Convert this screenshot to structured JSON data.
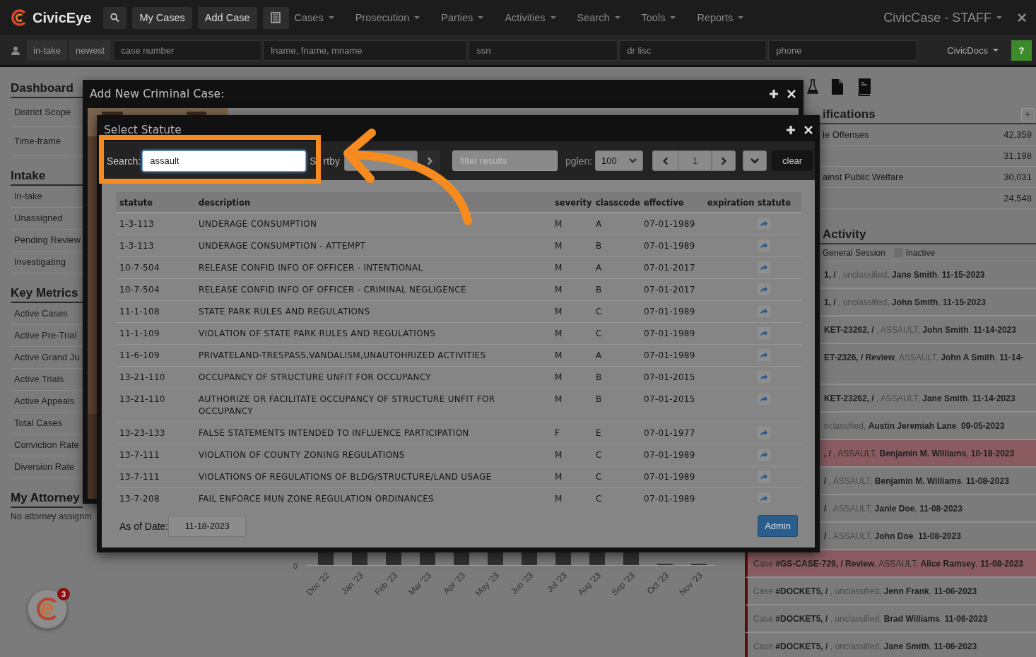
{
  "topbar": {
    "app_name": "CivicEye",
    "buttons": [
      "My Cases",
      "Add Case"
    ],
    "menus": [
      "Cases",
      "Prosecution",
      "Parties",
      "Activities",
      "Search",
      "Tools",
      "Reports"
    ],
    "account": "CivicCase - STAFF"
  },
  "quickbar": {
    "buttons": [
      "in-take",
      "newest"
    ],
    "fields": [
      {
        "placeholder": "case number"
      },
      {
        "placeholder": "lname, fname, mname"
      },
      {
        "placeholder": "ssn"
      },
      {
        "placeholder": "dr lisc"
      },
      {
        "placeholder": "phone"
      }
    ],
    "docs_menu": "CivicDocs",
    "help_button": "?"
  },
  "sidebar": {
    "sections": [
      {
        "heading": "Dashboard",
        "items": [
          "District Scope",
          "Time-frame"
        ]
      },
      {
        "heading": "Intake",
        "items": [
          "In-take",
          "Unassigned",
          "Pending Review",
          "Investigating"
        ]
      },
      {
        "heading": "Key Metrics",
        "items": [
          "Active Cases",
          "Active Pre-Trial",
          "Active Grand Ju",
          "Active Trials",
          "Active Appeals",
          "Total Cases",
          "Conviction Rate",
          "Diversion Rate"
        ]
      },
      {
        "heading": "My Attorney",
        "note": "No attorney assignm"
      }
    ]
  },
  "chart": {
    "y_tick": "0",
    "months": [
      "Dec '22",
      "Jan '23",
      "Feb '23",
      "Mar '23",
      "Apr '23",
      "May '23",
      "Jun '23",
      "Jul '23",
      "Aug '23",
      "Sep '23",
      "Oct '23",
      "Nov '23"
    ]
  },
  "right_panel": {
    "classifications": {
      "heading": "ifications",
      "add_button": "+",
      "rows": [
        {
          "label": "le Offenses",
          "count": "42,359"
        },
        {
          "count": "31,198"
        },
        {
          "label": "ainst Public Welfare",
          "count": "30,031"
        },
        {
          "count": "24,548"
        }
      ]
    },
    "activity": {
      "heading": "Activity",
      "legend": [
        {
          "label": "General Session"
        },
        {
          "label": "Inactive",
          "color": "#6e6e6e"
        }
      ],
      "items": [
        {
          "text": "**1, /** , unclassified, **Jane Smith**, **11-15-2023**",
          "highlighted": false,
          "wrapped": false
        },
        {
          "text": "**1, /** , unclassified, **John Smith**, **11-15-2023**",
          "highlighted": false,
          "wrapped": false
        },
        {
          "text": "**KET-23262, /** , ASSAULT, **John Smith**, **11-14-2023**",
          "highlighted": false,
          "wrapped": false
        },
        {
          "text": "**ET-2326, / Review**, ASSAULT, **John A Smith**, **11-14-**",
          "highlighted": false,
          "wrapped": true
        },
        {
          "text": "**KET-23262, /** , ASSAULT, **Jane Smith**, **11-14-2023**",
          "highlighted": false,
          "wrapped": false
        },
        {
          "text": "nclassified, **Austin Jeremiah Lane**, **09-05-2023**",
          "highlighted": false,
          "wrapped": false
        },
        {
          "text": "**, /** , ASSAULT, **Benjamin M. Williams**, **10-18-2023**",
          "highlighted": true,
          "wrapped": false
        },
        {
          "text": "**/** , ASSAULT, **Benjamin M. Williams**, **11-08-2023**",
          "highlighted": false,
          "wrapped": false
        },
        {
          "text": "**/** , ASSAULT, **Janie Doe**, **11-08-2023**",
          "highlighted": false,
          "wrapped": false
        },
        {
          "text": "**/** , ASSAULT, **John Doe**, **11-08-2023**",
          "highlighted": false,
          "wrapped": false
        },
        {
          "text": "Case **#GS-CASE-729, / Review**, ASSAULT, **Alice Ramsey**, **11-08-2023**",
          "highlighted": true,
          "wrapped": false
        },
        {
          "text": "Case **#DOCKET5, /** , unclassified, **Jenn Frank**, **11-06-2023**",
          "highlighted": false,
          "wrapped": false
        },
        {
          "text": "Case **#DOCKET5, /** , unclassified, **Brad Williams**, **11-06-2023**",
          "highlighted": false,
          "wrapped": false
        },
        {
          "text": "Case **#DOCKET5, /** , unclassified, **Jane Smith**, **11-06-2023**",
          "highlighted": false,
          "wrapped": false
        }
      ]
    }
  },
  "case_dialog": {
    "title": "Add New Criminal Case:"
  },
  "statute_dialog": {
    "title": "Select Statute",
    "search": {
      "label": "Search:",
      "value": "assault"
    },
    "sort": {
      "label_parts": [
        "S",
        "rtby"
      ]
    },
    "filter": {
      "placeholder": "filter results"
    },
    "page_length": {
      "label": "pglen:",
      "value": "100"
    },
    "page": "1",
    "clear_button": "clear",
    "table": {
      "columns": [
        "statute",
        "description",
        "severity",
        "classcode",
        "effective",
        "expiration",
        "statute"
      ],
      "rows": [
        {
          "statute": "1-3-113",
          "description": "UNDERAGE CONSUMPTION",
          "severity": "M",
          "classcode": "A",
          "effective": "07-01-1989"
        },
        {
          "statute": "1-3-113",
          "description": "UNDERAGE CONSUMPTION - ATTEMPT",
          "severity": "M",
          "classcode": "B",
          "effective": "07-01-1989"
        },
        {
          "statute": "10-7-504",
          "description": "RELEASE CONFID INFO OF OFFICER - INTENTIONAL",
          "severity": "M",
          "classcode": "A",
          "effective": "07-01-2017"
        },
        {
          "statute": "10-7-504",
          "description": "RELEASE CONFID INFO OF OFFICER - CRIMINAL NEGLIGENCE",
          "severity": "M",
          "classcode": "B",
          "effective": "07-01-2017"
        },
        {
          "statute": "11-1-108",
          "description": "STATE PARK RULES AND REGULATIONS",
          "severity": "M",
          "classcode": "C",
          "effective": "07-01-1989"
        },
        {
          "statute": "11-1-109",
          "description": "VIOLATION OF STATE PARK RULES AND REGULATIONS",
          "severity": "M",
          "classcode": "C",
          "effective": "07-01-1989"
        },
        {
          "statute": "11-6-109",
          "description": "PRIVATELAND-TRESPASS,VANDALISM,UNAUTOHRIZED ACTIVITIES",
          "severity": "M",
          "classcode": "A",
          "effective": "07-01-1989"
        },
        {
          "statute": "13-21-110",
          "description": "OCCUPANCY OF STRUCTURE UNFIT FOR OCCUPANCY",
          "severity": "M",
          "classcode": "B",
          "effective": "07-01-2015"
        },
        {
          "statute": "13-21-110",
          "description": "AUTHORIZE OR FACILITATE OCCUPANCY OF STRUCTURE UNFIT FOR OCCUPANCY",
          "severity": "M",
          "classcode": "B",
          "effective": "07-01-2015"
        },
        {
          "statute": "13-23-133",
          "description": "FALSE STATEMENTS INTENDED TO INFLUENCE PARTICIPATION",
          "severity": "F",
          "classcode": "E",
          "effective": "07-01-1977"
        },
        {
          "statute": "13-7-111",
          "description": "VIOLATION OF COUNTY ZONING REGULATIONS",
          "severity": "M",
          "classcode": "C",
          "effective": "07-01-1989"
        },
        {
          "statute": "13-7-111",
          "description": "VIOLATIONS OF REGULATIONS OF BLDG/STRUCTURE/LAND USAGE",
          "severity": "M",
          "classcode": "C",
          "effective": "07-01-1989"
        },
        {
          "statute": "13-7-208",
          "description": "FAIL ENFORCE MUN ZONE REGULATION ORDINANCES",
          "severity": "M",
          "classcode": "C",
          "effective": "07-01-1989"
        }
      ]
    },
    "as_of_date": {
      "label": "As of Date:",
      "value": "11-18-2023"
    },
    "admin_button": "Admin"
  },
  "chat": {
    "badge": "3"
  }
}
